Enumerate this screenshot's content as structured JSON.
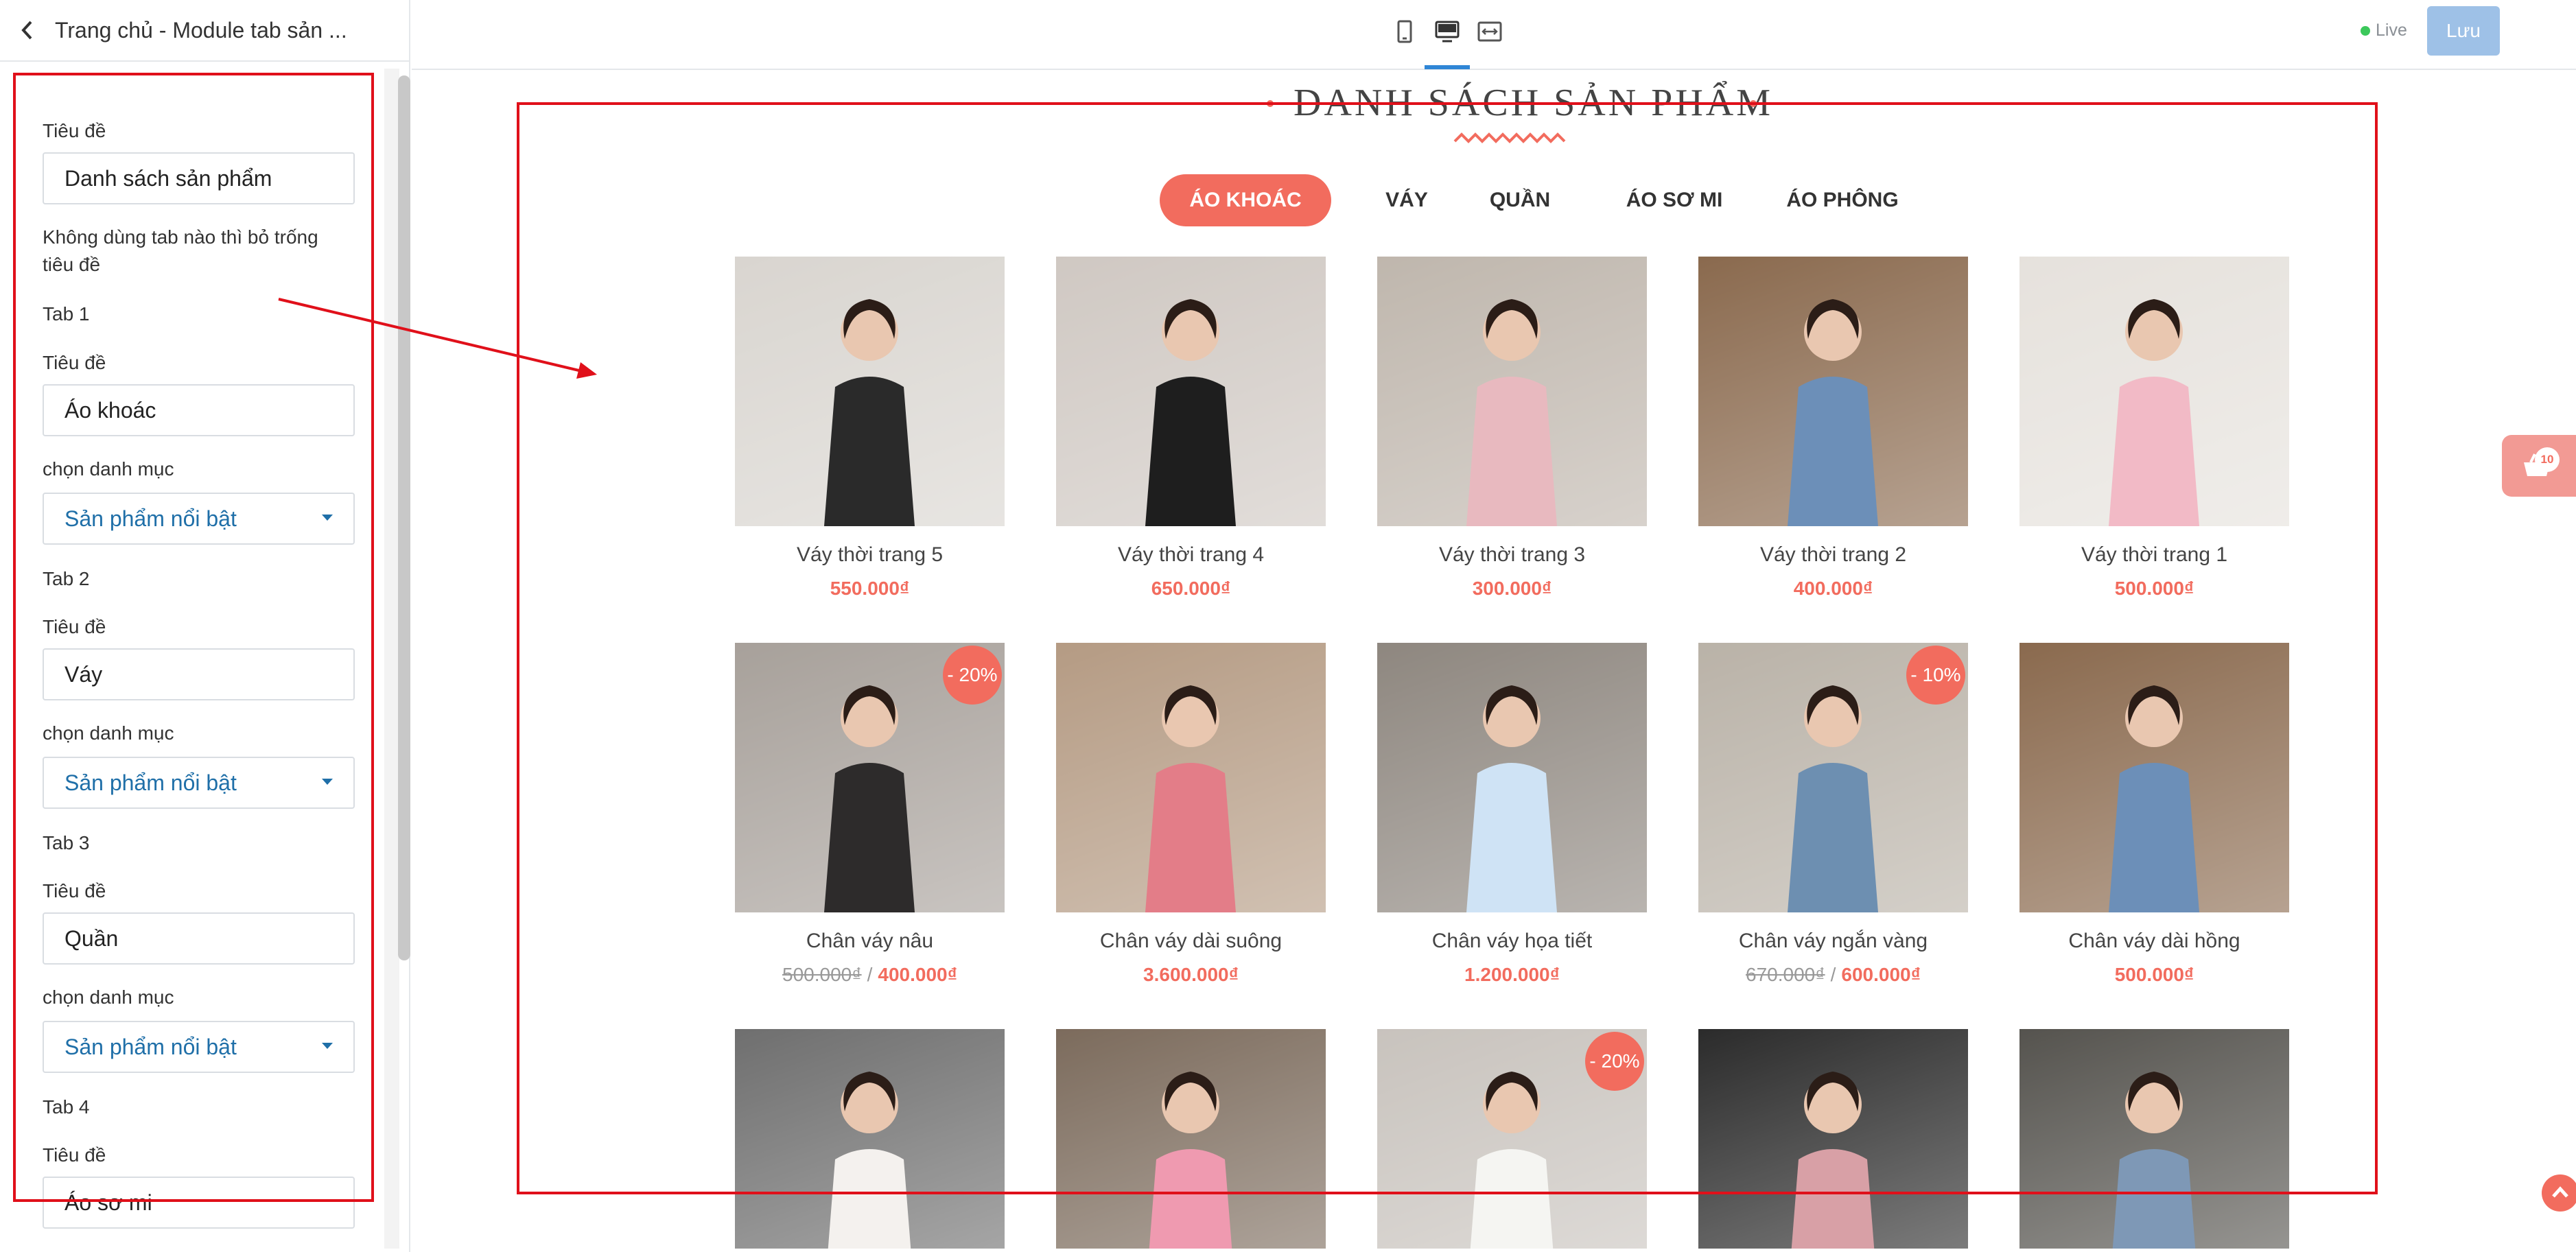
{
  "sidebar": {
    "title": "Trang chủ - Module tab sản ...",
    "fields": [
      {
        "label": "Tiêu đề",
        "value": "Danh sách sản phẩm"
      },
      {
        "note": "Không dùng tab nào thì bỏ trống tiêu đề"
      }
    ],
    "note_line1": "Không dùng tab nào thì bỏ trống",
    "note_line2": "tiêu đề",
    "heading_label": "Tiêu đề",
    "heading_value": "Danh sách sản phẩm",
    "tabs": [
      {
        "name": "Tab 1",
        "title_label": "Tiêu đề",
        "title_value": "Áo khoác",
        "cat_label": "chọn danh mục",
        "cat_value": "Sản phẩm nổi bật"
      },
      {
        "name": "Tab 2",
        "title_label": "Tiêu đề",
        "title_value": "Váy",
        "cat_label": "chọn danh mục",
        "cat_value": "Sản phẩm nổi bật"
      },
      {
        "name": "Tab 3",
        "title_label": "Tiêu đề",
        "title_value": "Quần",
        "cat_label": "chọn danh mục",
        "cat_value": "Sản phẩm nổi bật"
      },
      {
        "name": "Tab 4",
        "title_label": "Tiêu đề",
        "title_value": "Áo sơ mi"
      }
    ]
  },
  "topbar": {
    "devices": [
      "mobile-icon",
      "desktop-icon",
      "fullwidth-icon"
    ],
    "active_device": "desktop",
    "live_label": "Live",
    "save_label": "Lưu"
  },
  "section": {
    "title": "DANH SÁCH SẢN PHẨM",
    "tabs": [
      "ÁO KHOÁC",
      "VÁY",
      "QUẦN",
      "ÁO SƠ MI",
      "ÁO PHÔNG"
    ],
    "active_tab": 0,
    "products": [
      {
        "name": "Váy thời trang 5",
        "price": "550.000₫"
      },
      {
        "name": "Váy thời trang 4",
        "price": "650.000₫"
      },
      {
        "name": "Váy thời trang 3",
        "price": "300.000₫"
      },
      {
        "name": "Váy thời trang 2",
        "price": "400.000₫"
      },
      {
        "name": "Váy thời trang 1",
        "price": "500.000₫"
      },
      {
        "name": "Chân váy nâu",
        "old_price": "500.000₫",
        "sep": "/",
        "price": "400.000₫",
        "badge": "- 20%"
      },
      {
        "name": "Chân váy dài suông",
        "price": "3.600.000₫"
      },
      {
        "name": "Chân váy họa tiết",
        "price": "1.200.000₫"
      },
      {
        "name": "Chân váy ngắn vàng",
        "old_price": "670.000₫",
        "sep": "/",
        "price": "600.000₫",
        "badge": "- 10%"
      },
      {
        "name": "Chân váy dài hồng",
        "price": "500.000₫"
      },
      {
        "name": "",
        "price": ""
      },
      {
        "name": "",
        "price": ""
      },
      {
        "name": "",
        "price": "",
        "badge": "- 20%"
      },
      {
        "name": "",
        "price": ""
      },
      {
        "name": "",
        "price": ""
      }
    ]
  },
  "cart": {
    "count": "10"
  },
  "colors": {
    "accent": "#f26c5e",
    "annotation": "#e0101a",
    "primary": "#2f86d6",
    "save_button": "#9ec1e7",
    "live": "#3cc85b"
  }
}
